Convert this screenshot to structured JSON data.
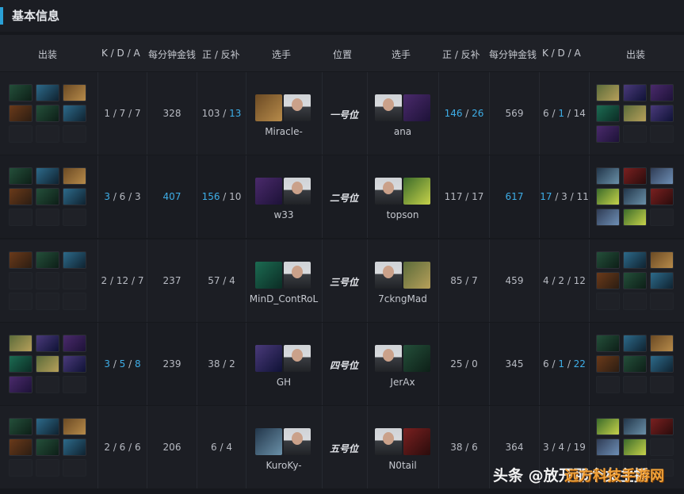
{
  "header": {
    "title": "基本信息"
  },
  "columns": {
    "items_left": "出装",
    "kda_left": "K / D / A",
    "gpm_left": "每分钟金钱",
    "lhdn_left": "正 / 反补",
    "player_left": "选手",
    "position": "位置",
    "player_right": "选手",
    "lhdn_right": "正 / 反补",
    "gpm_right": "每分钟金钱",
    "kda_right": "K / D / A",
    "items_right": "出装"
  },
  "colors": {
    "accent": "#2aa0d6",
    "highlight": "#3eaee8",
    "background": "#16181d"
  },
  "rows": [
    {
      "left": {
        "player": "Miracle-",
        "k": "1",
        "d": "7",
        "a": "7",
        "gpm": "328",
        "lh": "103",
        "dn": "13",
        "hl": [
          "dn"
        ]
      },
      "position": "一号位",
      "right": {
        "player": "ana",
        "k": "6",
        "d": "1",
        "a": "14",
        "gpm": "569",
        "lh": "146",
        "dn": "26",
        "hl": [
          "lh",
          "dn",
          "d"
        ]
      }
    },
    {
      "left": {
        "player": "w33",
        "k": "3",
        "d": "6",
        "a": "3",
        "gpm": "407",
        "lh": "156",
        "dn": "10",
        "hl": [
          "k",
          "gpm",
          "lh"
        ]
      },
      "position": "二号位",
      "right": {
        "player": "topson",
        "k": "17",
        "d": "3",
        "a": "11",
        "gpm": "617",
        "lh": "117",
        "dn": "17",
        "hl": [
          "gpm",
          "k"
        ]
      }
    },
    {
      "left": {
        "player": "MinD_ContRoL",
        "k": "2",
        "d": "12",
        "a": "7",
        "gpm": "237",
        "lh": "57",
        "dn": "4",
        "hl": []
      },
      "position": "三号位",
      "right": {
        "player": "7ckngMad",
        "k": "4",
        "d": "2",
        "a": "12",
        "gpm": "459",
        "lh": "85",
        "dn": "7",
        "hl": []
      }
    },
    {
      "left": {
        "player": "GH",
        "k": "3",
        "d": "5",
        "a": "8",
        "gpm": "239",
        "lh": "38",
        "dn": "2",
        "hl": [
          "k",
          "d",
          "a"
        ]
      },
      "position": "四号位",
      "right": {
        "player": "JerAx",
        "k": "6",
        "d": "1",
        "a": "22",
        "gpm": "345",
        "lh": "25",
        "dn": "0",
        "hl": [
          "d",
          "a"
        ]
      }
    },
    {
      "left": {
        "player": "KuroKy-",
        "k": "2",
        "d": "6",
        "a": "6",
        "gpm": "206",
        "lh": "6",
        "dn": "4",
        "hl": []
      },
      "position": "五号位",
      "right": {
        "player": "N0tail",
        "k": "3",
        "d": "4",
        "a": "19",
        "gpm": "364",
        "lh": "38",
        "dn": "6",
        "hl": []
      }
    }
  ],
  "watermark": {
    "text": "头条 @放开那个女主播",
    "site": "远方科技手游网"
  }
}
